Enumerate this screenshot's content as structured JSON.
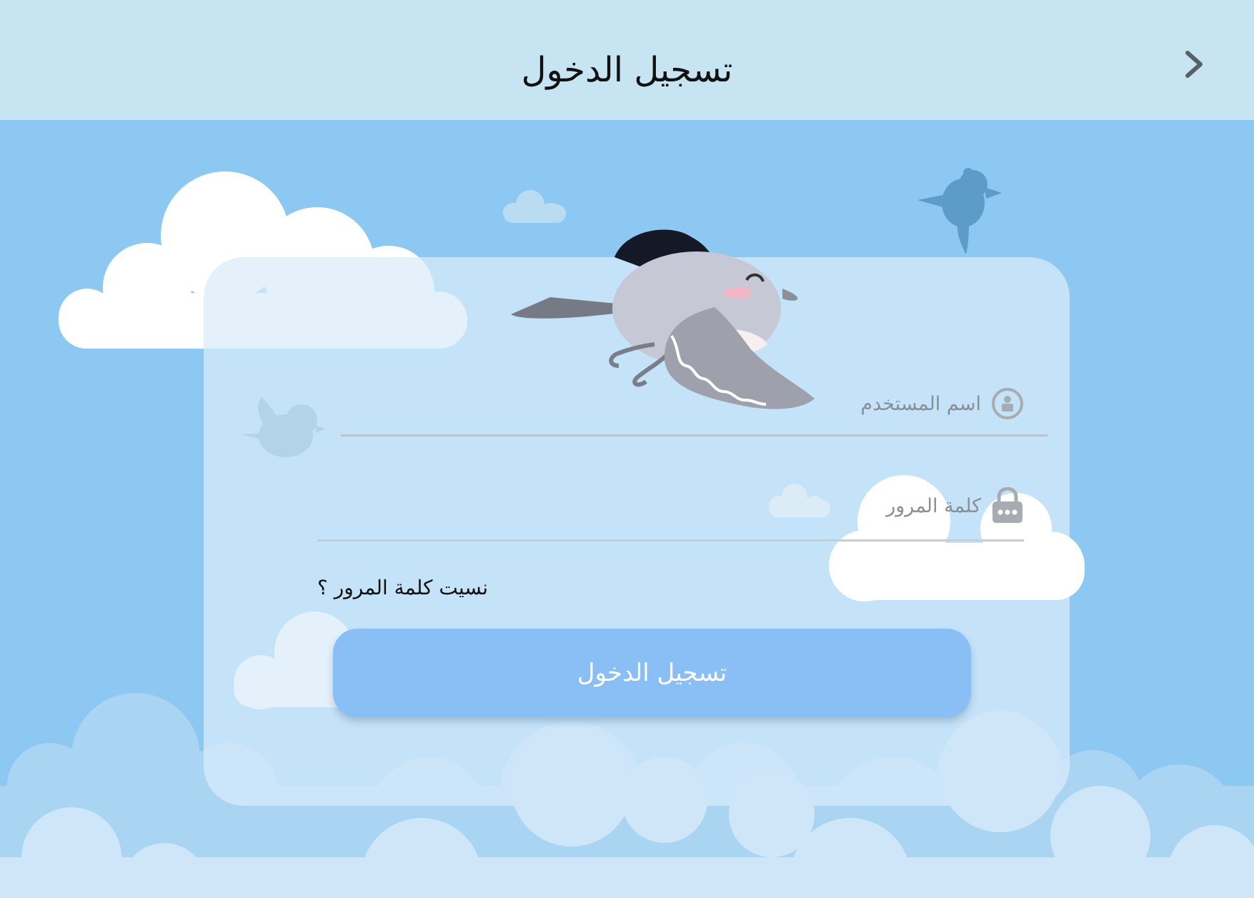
{
  "header": {
    "title": "تسجيل الدخول",
    "back_icon": "chevron-right-icon"
  },
  "form": {
    "username": {
      "placeholder": "اسم المستخدم",
      "icon": "user-icon"
    },
    "password": {
      "placeholder": "كلمة المرور",
      "icon": "lock-icon"
    },
    "forgot_password": "نسيت كلمة المرور ؟",
    "submit_label": "تسجيل الدخول"
  },
  "theme": {
    "header_bg": "#c6e4f2",
    "sky_bg": "#8cc8f2",
    "button_bg": "#8abff5"
  }
}
